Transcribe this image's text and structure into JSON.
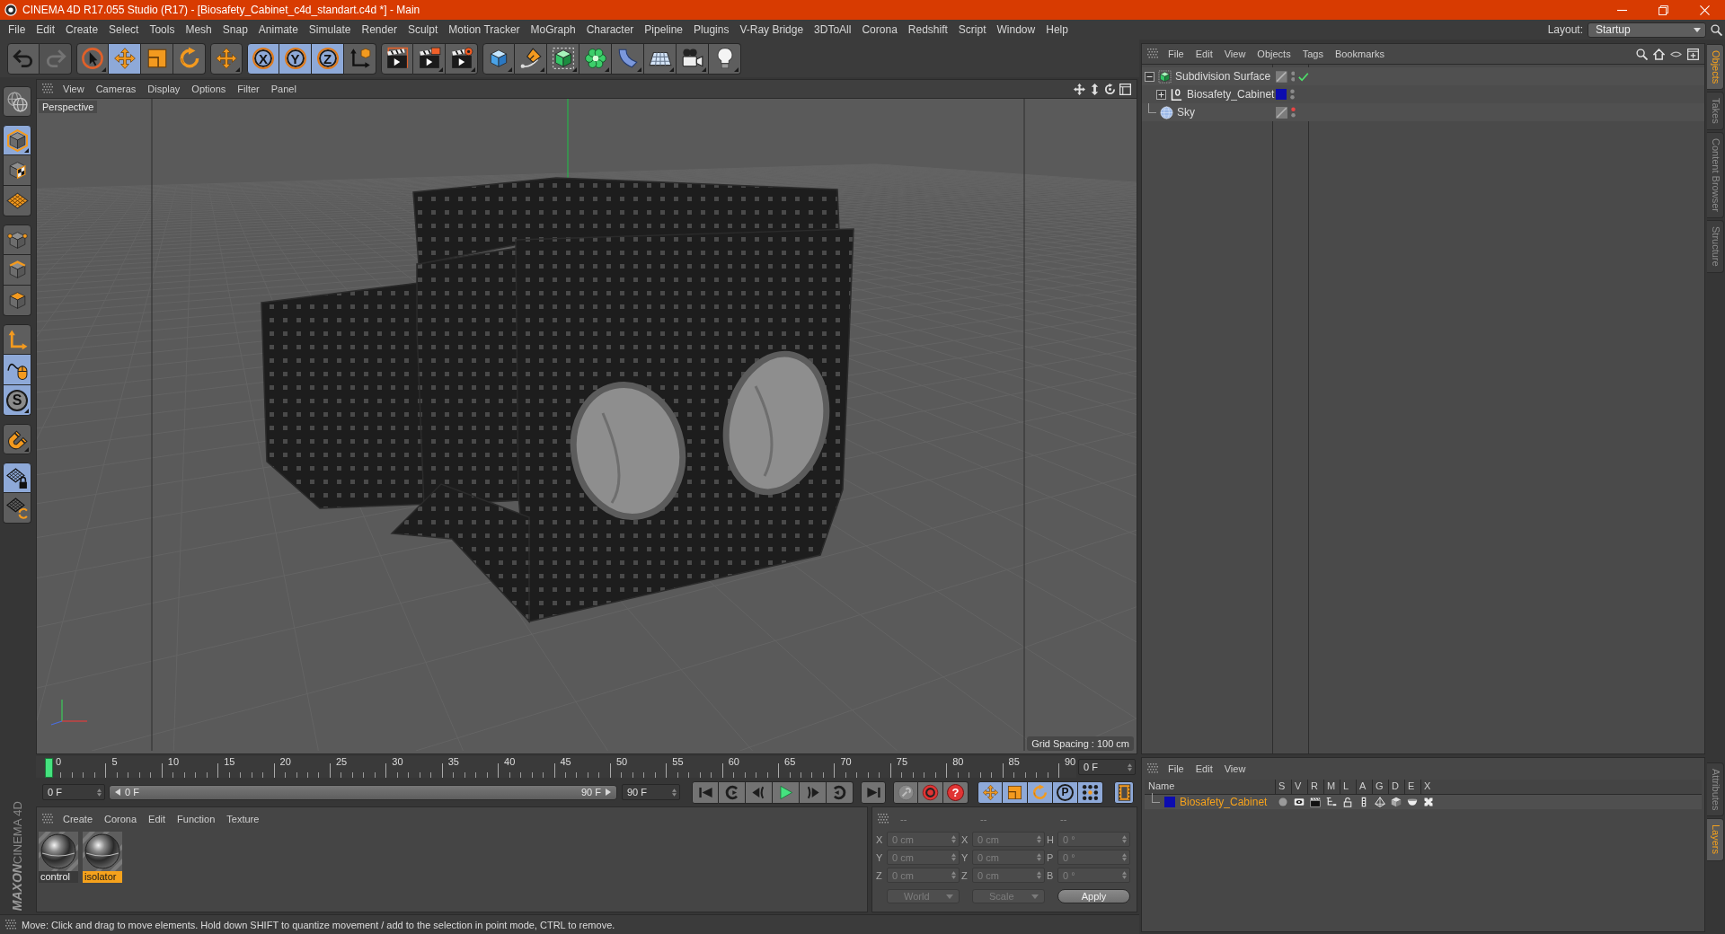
{
  "window": {
    "title": "CINEMA 4D R17.055 Studio (R17) - [Biosafety_Cabinet_c4d_standart.c4d *] - Main"
  },
  "menu_bar": [
    "File",
    "Edit",
    "Create",
    "Select",
    "Tools",
    "Mesh",
    "Snap",
    "Animate",
    "Simulate",
    "Render",
    "Sculpt",
    "Motion Tracker",
    "MoGraph",
    "Character",
    "Pipeline",
    "Plugins",
    "V-Ray Bridge",
    "3DToAll",
    "Corona",
    "Redshift",
    "Script",
    "Window",
    "Help"
  ],
  "layout": {
    "label": "Layout:",
    "value": "Startup"
  },
  "toolbar": [
    [
      {
        "kind": "undo",
        "disabled": false
      },
      {
        "kind": "redo",
        "disabled": true
      }
    ],
    [
      {
        "kind": "live-selection",
        "on": false
      },
      {
        "kind": "move",
        "on": true
      },
      {
        "kind": "scale",
        "on": false
      },
      {
        "kind": "rotate",
        "on": false
      }
    ],
    [
      {
        "kind": "recent-move",
        "on": false
      }
    ],
    [
      {
        "kind": "axis-lock",
        "label": "X",
        "on": true
      },
      {
        "kind": "axis-lock",
        "label": "Y",
        "on": true
      },
      {
        "kind": "axis-lock",
        "label": "Z",
        "on": true
      },
      {
        "kind": "coordinate-system",
        "on": false
      }
    ],
    [
      {
        "kind": "render-view",
        "on": false
      },
      {
        "kind": "render-picture",
        "on": false
      },
      {
        "kind": "render-settings",
        "on": false
      }
    ],
    [
      {
        "kind": "cube",
        "on": false
      },
      {
        "kind": "pen",
        "on": false
      },
      {
        "kind": "subdivision",
        "on": false
      },
      {
        "kind": "cloner",
        "on": false
      },
      {
        "kind": "bend",
        "on": false
      },
      {
        "kind": "floor",
        "on": false
      },
      {
        "kind": "camera",
        "on": false
      },
      {
        "kind": "light",
        "on": false
      }
    ]
  ],
  "left_toolbar": [
    [
      {
        "kind": "make-editable",
        "on": false
      }
    ],
    [
      {
        "kind": "model-mode",
        "on": true
      },
      {
        "kind": "texture-mode",
        "on": false
      },
      {
        "kind": "workplane-mode",
        "on": false
      }
    ],
    [
      {
        "kind": "points-mode",
        "on": false
      },
      {
        "kind": "edges-mode",
        "on": false
      },
      {
        "kind": "polygons-mode",
        "on": false
      }
    ],
    [
      {
        "kind": "axis-mode",
        "on": false
      },
      {
        "kind": "tweak-mode",
        "on": true
      },
      {
        "kind": "solo",
        "label": "S",
        "on": true
      }
    ],
    [
      {
        "kind": "snap",
        "on": false
      }
    ],
    [
      {
        "kind": "workplane-lock",
        "on": true
      },
      {
        "kind": "workplane-align",
        "on": false
      }
    ]
  ],
  "viewport": {
    "menus": [
      "View",
      "Cameras",
      "Display",
      "Options",
      "Filter",
      "Panel"
    ],
    "camera": "Perspective",
    "grid_spacing": "Grid Spacing : 100 cm"
  },
  "timeline": {
    "ticks": [
      "0",
      "5",
      "10",
      "15",
      "20",
      "25",
      "30",
      "35",
      "40",
      "45",
      "50",
      "55",
      "60",
      "65",
      "70",
      "75",
      "80",
      "85",
      "90"
    ],
    "playhead": {
      "level": 0
    },
    "frame": "0 F"
  },
  "transport": {
    "start_field": "0 F",
    "range_slider": {
      "start": "0 F",
      "end": "90 F",
      "level": 1
    },
    "end_field": "90 F",
    "groups": [
      [
        {
          "kind": "go-start"
        },
        {
          "kind": "prev-key"
        },
        {
          "kind": "prev-frame"
        },
        {
          "kind": "play"
        },
        {
          "kind": "next-frame"
        },
        {
          "kind": "next-key"
        }
      ],
      [
        {
          "kind": "go-end"
        }
      ],
      [
        {
          "kind": "record-active"
        },
        {
          "kind": "autokey"
        },
        {
          "kind": "keyframe-selection",
          "label": "?"
        }
      ],
      [
        {
          "kind": "key-position",
          "on": true
        },
        {
          "kind": "key-scale",
          "on": true
        },
        {
          "kind": "key-rotation",
          "on": true
        },
        {
          "kind": "key-parameter",
          "label": "P",
          "on": true
        },
        {
          "kind": "key-point-level",
          "on": true
        }
      ],
      [
        {
          "kind": "timeline",
          "on": true
        }
      ]
    ]
  },
  "materials": {
    "menus": [
      "Create",
      "Corona",
      "Edit",
      "Function",
      "Texture"
    ],
    "items": [
      {
        "name": "control",
        "selected": false
      },
      {
        "name": "isolator",
        "selected": true
      }
    ]
  },
  "coordinates": {
    "headers": [
      "--",
      "--",
      "--"
    ],
    "disabled": true,
    "rows": [
      {
        "position_axis": "X",
        "position": "0 cm",
        "size_axis": "X",
        "size": "0 cm",
        "rotation_axis": "H",
        "rotation": "0 °"
      },
      {
        "position_axis": "Y",
        "position": "0 cm",
        "size_axis": "Y",
        "size": "0 cm",
        "rotation_axis": "P",
        "rotation": "0 °"
      },
      {
        "position_axis": "Z",
        "position": "0 cm",
        "size_axis": "Z",
        "size": "0 cm",
        "rotation_axis": "B",
        "rotation": "0 °"
      }
    ],
    "mode": "World",
    "size_mode": "Scale",
    "apply": "Apply"
  },
  "status_bar": {
    "text": "Move: Click and drag to move elements. Hold down SHIFT to quantize movement / add to the selection in point mode, CTRL to remove."
  },
  "logo": {
    "brand": "MAXON",
    "product": "CINEMA 4D"
  },
  "object_manager": {
    "menus": [
      "File",
      "Edit",
      "View",
      "Objects",
      "Tags",
      "Bookmarks"
    ],
    "objects": [
      {
        "name": "Subdivision Surface",
        "kind": "subdivision",
        "expanded": true,
        "enabled": true,
        "hidden_in_editor": false,
        "children": [
          {
            "name": "Biosafety_Cabinet",
            "kind": "null",
            "expanded": false,
            "color": "#0c0cb0",
            "hidden_in_editor": false
          }
        ]
      },
      {
        "name": "Sky",
        "kind": "sky",
        "hidden_in_editor": true
      }
    ]
  },
  "layer_manager": {
    "menus": [
      "File",
      "Edit",
      "View"
    ],
    "columns": [
      "Name",
      "S",
      "V",
      "R",
      "M",
      "L",
      "A",
      "G",
      "D",
      "E",
      "X"
    ],
    "layers": [
      {
        "name": "Biosafety_Cabinet",
        "color": "#0c0cb0",
        "selected": true
      }
    ]
  },
  "side_tabs": {
    "top": [
      {
        "label": "Objects",
        "selected": true
      },
      {
        "label": "Takes",
        "selected": false
      },
      {
        "label": "Content Browser",
        "selected": false
      },
      {
        "label": "Structure",
        "selected": false
      }
    ],
    "bottom": [
      {
        "label": "Attributes",
        "selected": false
      },
      {
        "label": "Layers",
        "selected": true
      }
    ]
  }
}
